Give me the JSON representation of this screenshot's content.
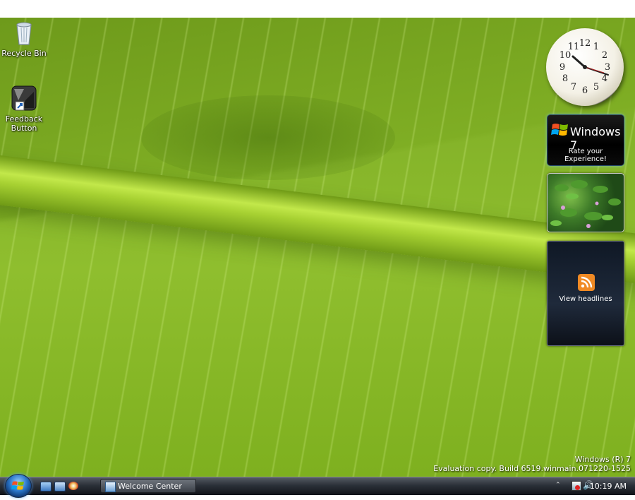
{
  "desktop": {
    "icons": [
      {
        "label": "Recycle Bin",
        "icon": "recycle-bin-icon"
      },
      {
        "label": "Feedback\nButton",
        "label_line1": "Feedback",
        "label_line2": "Button",
        "icon": "feedback-button-icon"
      }
    ],
    "watermark": {
      "line1": "Windows (R) 7",
      "line2": "Evaluation copy. Build 6519.winmain.071220-1525"
    }
  },
  "gadgets": {
    "clock": {
      "numbers": [
        "12",
        "1",
        "2",
        "3",
        "4",
        "5",
        "6",
        "7",
        "8",
        "9",
        "10",
        "11"
      ],
      "time": "10:19"
    },
    "win7": {
      "title": "Windows 7",
      "subtitle": "Rate your Experience!"
    },
    "slideshow": {
      "description": "slideshow-photo"
    },
    "feed": {
      "label": "View headlines",
      "icon": "rss-icon"
    }
  },
  "taskbar": {
    "start_icon": "windows-orb-icon",
    "quicklaunch": [
      "show-desktop-icon",
      "switch-windows-icon",
      "internet-explorer-icon"
    ],
    "buttons": [
      {
        "label": "Welcome Center",
        "icon": "welcome-center-icon"
      }
    ],
    "tray": {
      "time": "10:19 AM",
      "icons": [
        "chevron-up-icon",
        "network-icon",
        "volume-icon"
      ]
    }
  },
  "colors": {
    "accent": "#2a75c9",
    "feed_orange": "#f08a24"
  }
}
